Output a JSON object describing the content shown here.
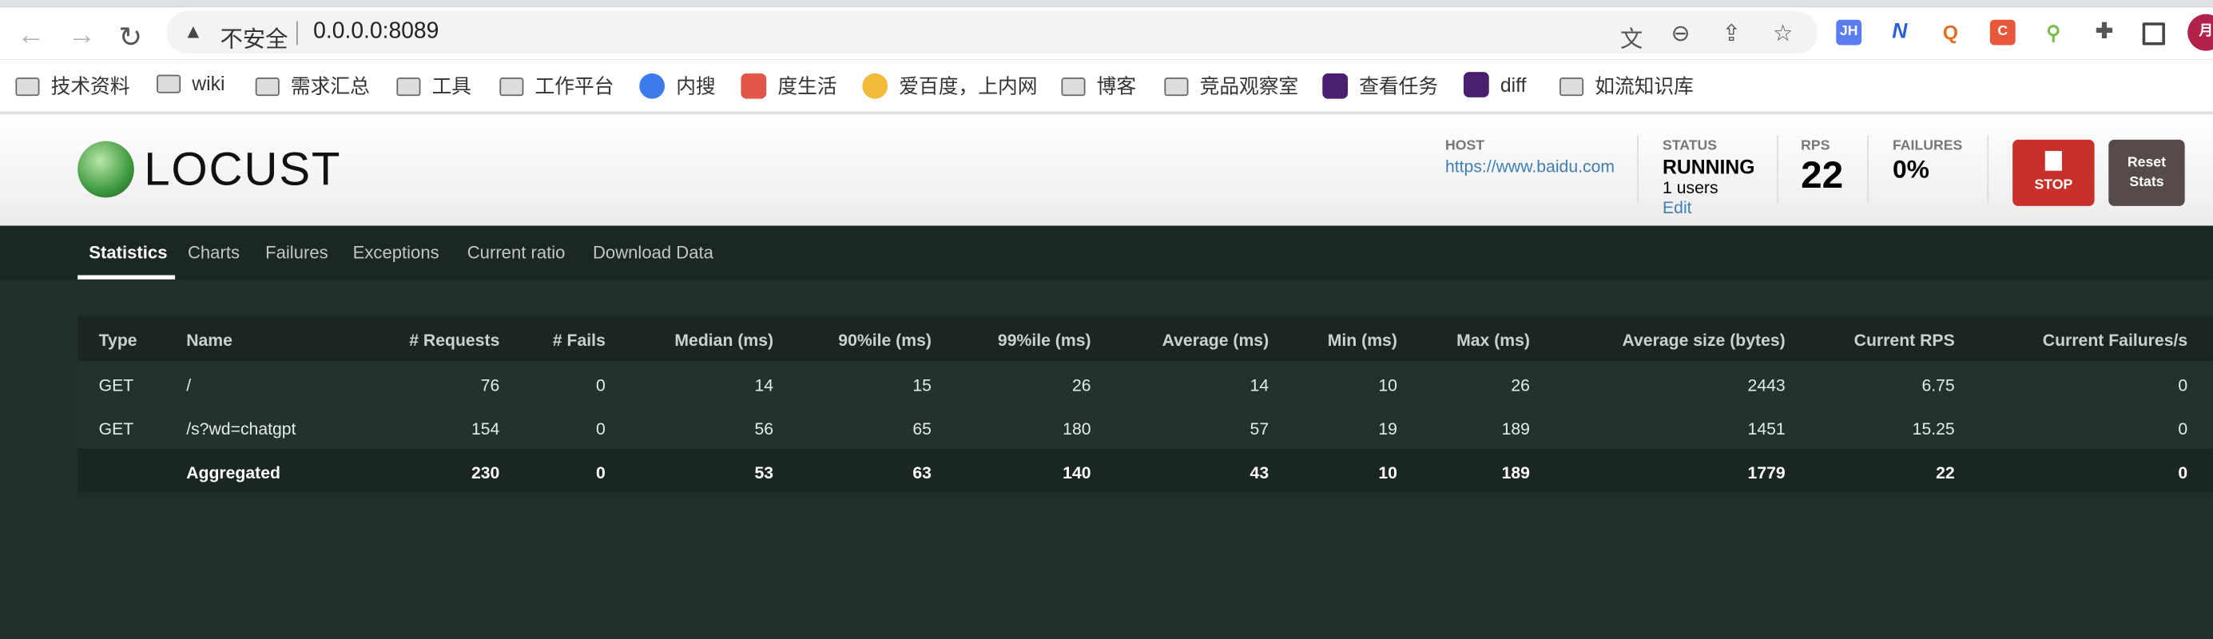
{
  "browser": {
    "security_label": "不安全",
    "url": "0.0.0.0:8089",
    "extensions": [
      {
        "label": "JH",
        "color": "#5b7cf0"
      },
      {
        "label": "N",
        "color": "#ffffff"
      },
      {
        "label": "Q",
        "color": "#ffffff"
      },
      {
        "label": "C",
        "color": "#e8573a"
      },
      {
        "label": "",
        "color": "#ffffff"
      }
    ],
    "profile_label": "月"
  },
  "bookmarks": [
    {
      "label": "技术资料",
      "icon": "folder-icon"
    },
    {
      "label": "wiki",
      "icon": "folder-icon"
    },
    {
      "label": "需求汇总",
      "icon": "folder-icon"
    },
    {
      "label": "工具",
      "icon": "folder-icon"
    },
    {
      "label": "工作平台",
      "icon": "folder-icon"
    },
    {
      "label": "内搜",
      "icon": "baidu-paw-icon"
    },
    {
      "label": "度生活",
      "icon": "life-icon"
    },
    {
      "label": "爱百度，上内网",
      "icon": "emoji-icon"
    },
    {
      "label": "博客",
      "icon": "folder-icon"
    },
    {
      "label": "竞品观察室",
      "icon": "folder-icon"
    },
    {
      "label": "查看任务",
      "icon": "p-app-icon"
    },
    {
      "label": "diff",
      "icon": "p-app-icon"
    },
    {
      "label": "如流知识库",
      "icon": "folder-icon"
    }
  ],
  "header": {
    "logo_text": "LOCUST",
    "host_label": "HOST",
    "host": "https://www.baidu.com",
    "status_label": "STATUS",
    "status": "RUNNING",
    "users": "1 users",
    "edit": "Edit",
    "rps_label": "RPS",
    "rps": "22",
    "failures_label": "FAILURES",
    "failures": "0%",
    "stop": "STOP",
    "reset": "Reset Stats"
  },
  "tabs": [
    "Statistics",
    "Charts",
    "Failures",
    "Exceptions",
    "Current ratio",
    "Download Data"
  ],
  "table": {
    "columns": [
      "Type",
      "Name",
      "# Requests",
      "# Fails",
      "Median (ms)",
      "90%ile (ms)",
      "99%ile (ms)",
      "Average (ms)",
      "Min (ms)",
      "Max (ms)",
      "Average size (bytes)",
      "Current RPS",
      "Current Failures/s"
    ],
    "rows": [
      [
        "GET",
        "/",
        "76",
        "0",
        "14",
        "15",
        "26",
        "14",
        "10",
        "26",
        "2443",
        "6.75",
        "0"
      ],
      [
        "GET",
        "/s?wd=chatgpt",
        "154",
        "0",
        "56",
        "65",
        "180",
        "57",
        "19",
        "189",
        "1451",
        "15.25",
        "0"
      ]
    ],
    "aggregated": [
      "",
      "Aggregated",
      "230",
      "0",
      "53",
      "63",
      "140",
      "43",
      "10",
      "189",
      "1779",
      "22",
      "0"
    ]
  }
}
